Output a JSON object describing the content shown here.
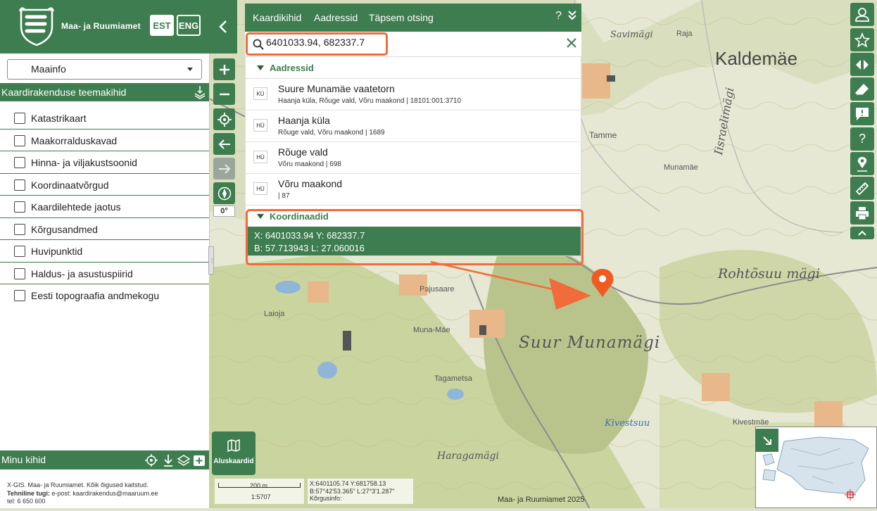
{
  "header": {
    "brand": "Maa- ja Ruumiamet",
    "lang_est": "EST",
    "lang_eng": "ENG"
  },
  "maainfo": {
    "selected": "Maainfo"
  },
  "themes": {
    "title": "Kaardirakenduse teemakihid",
    "layers": [
      {
        "label": "Katastrikaart",
        "checked": false
      },
      {
        "label": "Maakorralduskavad",
        "checked": false
      },
      {
        "label": "Hinna- ja viljakustsoonid",
        "checked": false
      },
      {
        "label": "Koordinaatvõrgud",
        "checked": false
      },
      {
        "label": "Kaardilehtede jaotus",
        "checked": false
      },
      {
        "label": "Kõrgusandmed",
        "checked": false
      },
      {
        "label": "Huvipunktid",
        "checked": false
      },
      {
        "label": "Haldus- ja asustuspiirid",
        "checked": false
      },
      {
        "label": "Eesti topograafia andmekogu",
        "checked": false
      }
    ]
  },
  "minu_kihid": {
    "title": "Minu kihid"
  },
  "footer": {
    "line1": "X-GIS. Maa- ja Ruumiamet. Kõik õigused kaitstud.",
    "support_label": "Tehniline tugi:",
    "support_text": "e-post: kaardirakendus@maaruum.ee",
    "phone": "tel: 6 650 600"
  },
  "search": {
    "tabs": [
      "Kaardikihid",
      "Aadressid",
      "Täpsem otsing"
    ],
    "help": "?",
    "query": "6401033.94, 682337.7",
    "addresses_header": "Aadressid",
    "results": [
      {
        "badge": "KÜ",
        "title": "Suure Munamäe vaatetorn",
        "subtitle": "Haanja küla, Rõuge vald, Võru maakond | 18101:001:3710"
      },
      {
        "badge": "HÜ",
        "title": "Haanja küla",
        "subtitle": "Rõuge vald, Võru maakond | 1689"
      },
      {
        "badge": "HÜ",
        "title": "Rõuge vald",
        "subtitle": "Võru maakond | 698"
      },
      {
        "badge": "HÜ",
        "title": "Võru maakond",
        "subtitle": "| 87"
      }
    ],
    "coords_header": "Koordinaadid",
    "coord_line1": "X: 6401033.94 Y: 682337.7",
    "coord_line2": "B: 57.713943 L: 27.060016"
  },
  "map": {
    "rotation": "0°",
    "aluskaardid": "Aluskaardid",
    "scale_distance": "200 m",
    "scale_ratio": "1:5707",
    "cursor_xy": "X:6401105.74 Y:681758.13",
    "cursor_bl": "B:57°42'53.365\" L:27°3'1.287\"",
    "cursor_height": "Kõrgusinfo:",
    "copyright": "Maa- ja Ruumiamet 2025",
    "labels": {
      "kaldemae": "Kaldemäe",
      "savimagi": "Savimägi",
      "raja": "Raja",
      "israelimagi": "Iisraelimägi",
      "tamme": "Tamme",
      "munamae": "Munamäe",
      "rohtosuu": "Rohtõsuu mägi",
      "pajusaare": "Pajusaare",
      "laioja": "Laioja",
      "munamae2": "Muna-Mäe",
      "suurmunamagi": "Suur Munamägi",
      "tagametsa": "Tagametsa",
      "kivestsuu": "Kivestsuu",
      "kivestmae": "Kivestmäe",
      "haragamagi": "Haragamägi"
    }
  },
  "colors": {
    "brand_green": "#3e7d4f",
    "highlight_orange": "#f26b3a",
    "marker": "#f15a22"
  }
}
